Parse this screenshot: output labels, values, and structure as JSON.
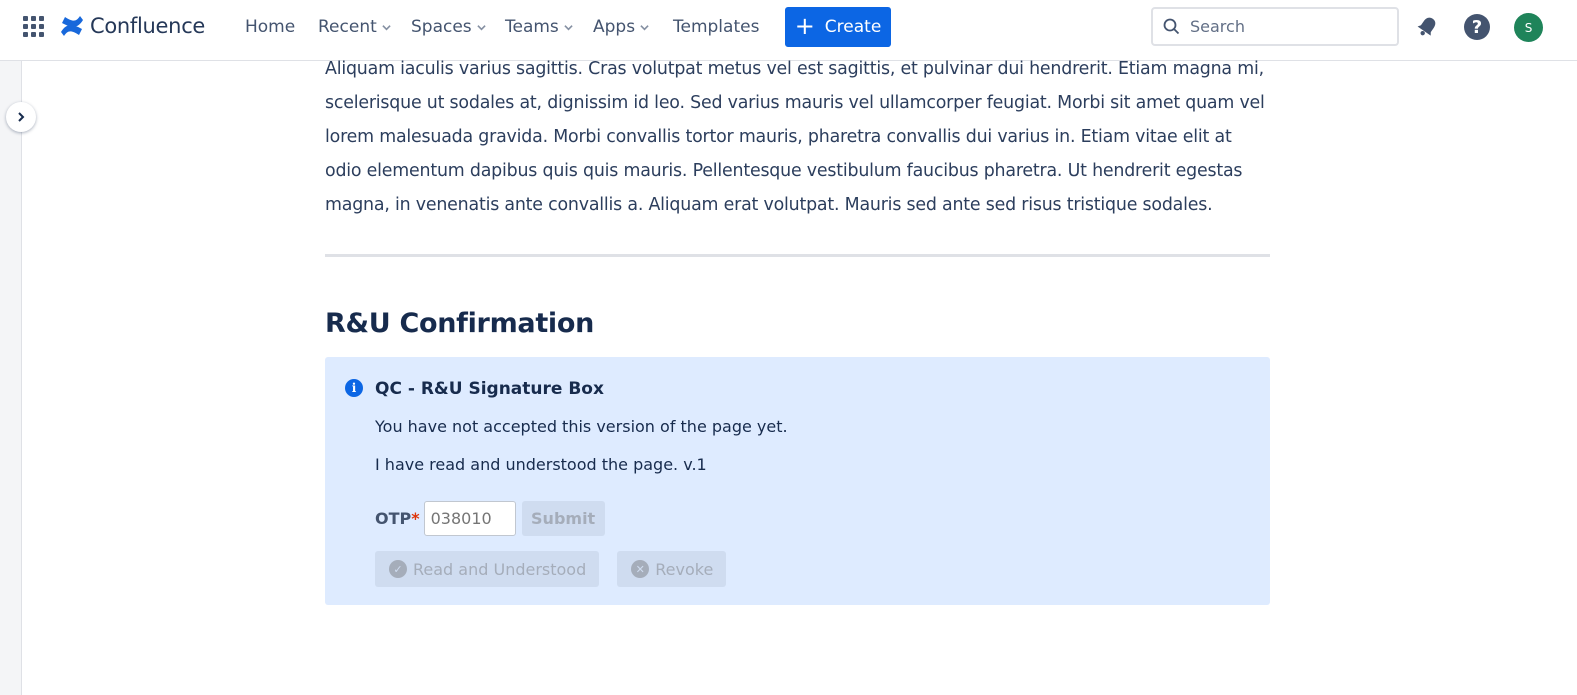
{
  "header": {
    "logo_text": "Confluence",
    "nav": [
      {
        "label": "Home",
        "has_dropdown": false
      },
      {
        "label": "Recent",
        "has_dropdown": true
      },
      {
        "label": "Spaces",
        "has_dropdown": true
      },
      {
        "label": "Teams",
        "has_dropdown": true
      },
      {
        "label": "Apps",
        "has_dropdown": true
      },
      {
        "label": "Templates",
        "has_dropdown": false
      }
    ],
    "create_label": "Create",
    "search_placeholder": "Search",
    "avatar_initial": "S",
    "help_glyph": "?"
  },
  "content": {
    "paragraph": "Aliquam iaculis varius sagittis. Cras volutpat metus vel est sagittis, et pulvinar dui hendrerit. Etiam magna mi, scelerisque ut sodales at, dignissim id leo. Sed varius mauris vel ullamcorper feugiat. Morbi sit amet quam vel lorem malesuada gravida. Morbi convallis tortor mauris, pharetra convallis dui varius in. Etiam vitae elit at odio elementum dapibus quis quis mauris. Pellentesque vestibulum faucibus pharetra. Ut hendrerit egestas magna, in venenatis ante convallis a. Aliquam erat volutpat. Mauris sed ante sed risus tristique sodales.",
    "heading": "R&U Confirmation"
  },
  "panel": {
    "title": "QC - R&U Signature Box",
    "status_text": "You have not accepted this version of the page yet.",
    "statement": "I have read and understood the page. v.1",
    "otp_label": "OTP",
    "otp_required_mark": "*",
    "otp_placeholder": "038010",
    "submit_label": "Submit",
    "read_label": "Read and Understood",
    "revoke_label": "Revoke"
  },
  "colors": {
    "brand_blue": "#0c66e4",
    "panel_bg": "#deebff",
    "avatar_green": "#1f845a"
  }
}
